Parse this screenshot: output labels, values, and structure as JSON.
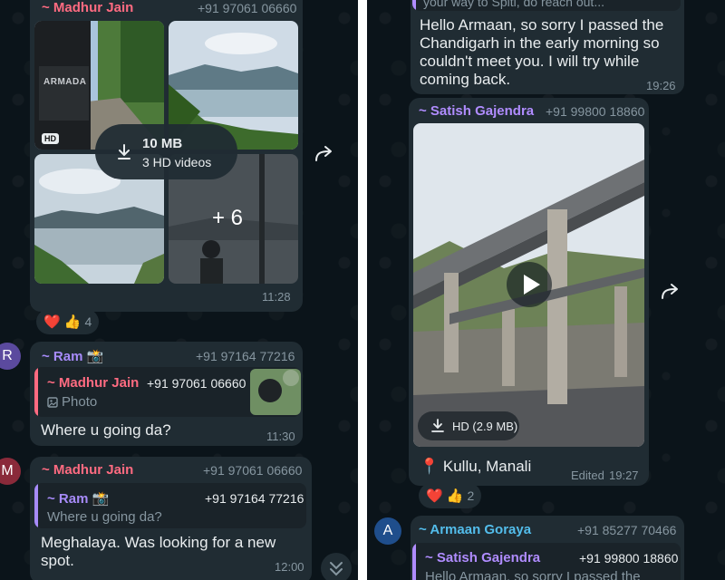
{
  "left_chat": {
    "album_message": {
      "sender": "~ Madhur Jain",
      "phone": "+91 97061 06660",
      "download_size": "10 MB",
      "download_desc": "3 HD videos",
      "more_count": "+ 6",
      "hd_badge": "HD",
      "car_text": "ARMADA",
      "time": "11:28",
      "reactions": {
        "emojis": "❤️ 👍",
        "count": "4"
      }
    },
    "ram_message": {
      "avatar_letter": "R",
      "sender": "~ Ram 📸",
      "phone": "+91 97164 77216",
      "quote_sender": "~ Madhur Jain",
      "quote_phone": "+91 97061 06660",
      "quote_text": "Photo",
      "text": "Where u going da?",
      "time": "11:30"
    },
    "madhur_reply": {
      "avatar_letter": "M",
      "sender": "~ Madhur Jain",
      "phone": "+91 97061 06660",
      "quote_sender": "~ Ram 📸",
      "quote_phone": "+91 97164 77216",
      "quote_text": "Where u going da?",
      "text": "Meghalaya. Was looking for a new spot.",
      "time": "12:00"
    },
    "scroll_down_icon": "chevron-double-down"
  },
  "right_chat": {
    "top_message": {
      "quote_fragment": "your way to Spiti, do reach out...",
      "text": "Hello Armaan, so sorry I passed the Chandigarh in the early morning so couldn't meet you. I will try while coming back.",
      "time": "19:26"
    },
    "video_message": {
      "sender": "~ Satish Gajendra",
      "phone": "+91 99800 18860",
      "download_label": "HD (2.9 MB)",
      "caption": "📍 Kullu, Manali",
      "edited_label": "Edited",
      "time": "19:27",
      "reactions": {
        "emojis": "❤️ 👍",
        "count": "2"
      }
    },
    "armaan_message": {
      "avatar_letter": "A",
      "sender": "~ Armaan Goraya",
      "phone": "+91 85277 70466",
      "quote_sender": "~ Satish Gajendra",
      "quote_phone": "+91 99800 18860",
      "quote_text": "Hello Armaan, so sorry I passed the"
    }
  },
  "colors": {
    "background": "#0b141a",
    "bubble": "#202c33",
    "madhur_name": "#ff6b81",
    "ram_name": "#a78bfa",
    "satish_name": "#b08cff",
    "armaan_name": "#53bdeb"
  }
}
